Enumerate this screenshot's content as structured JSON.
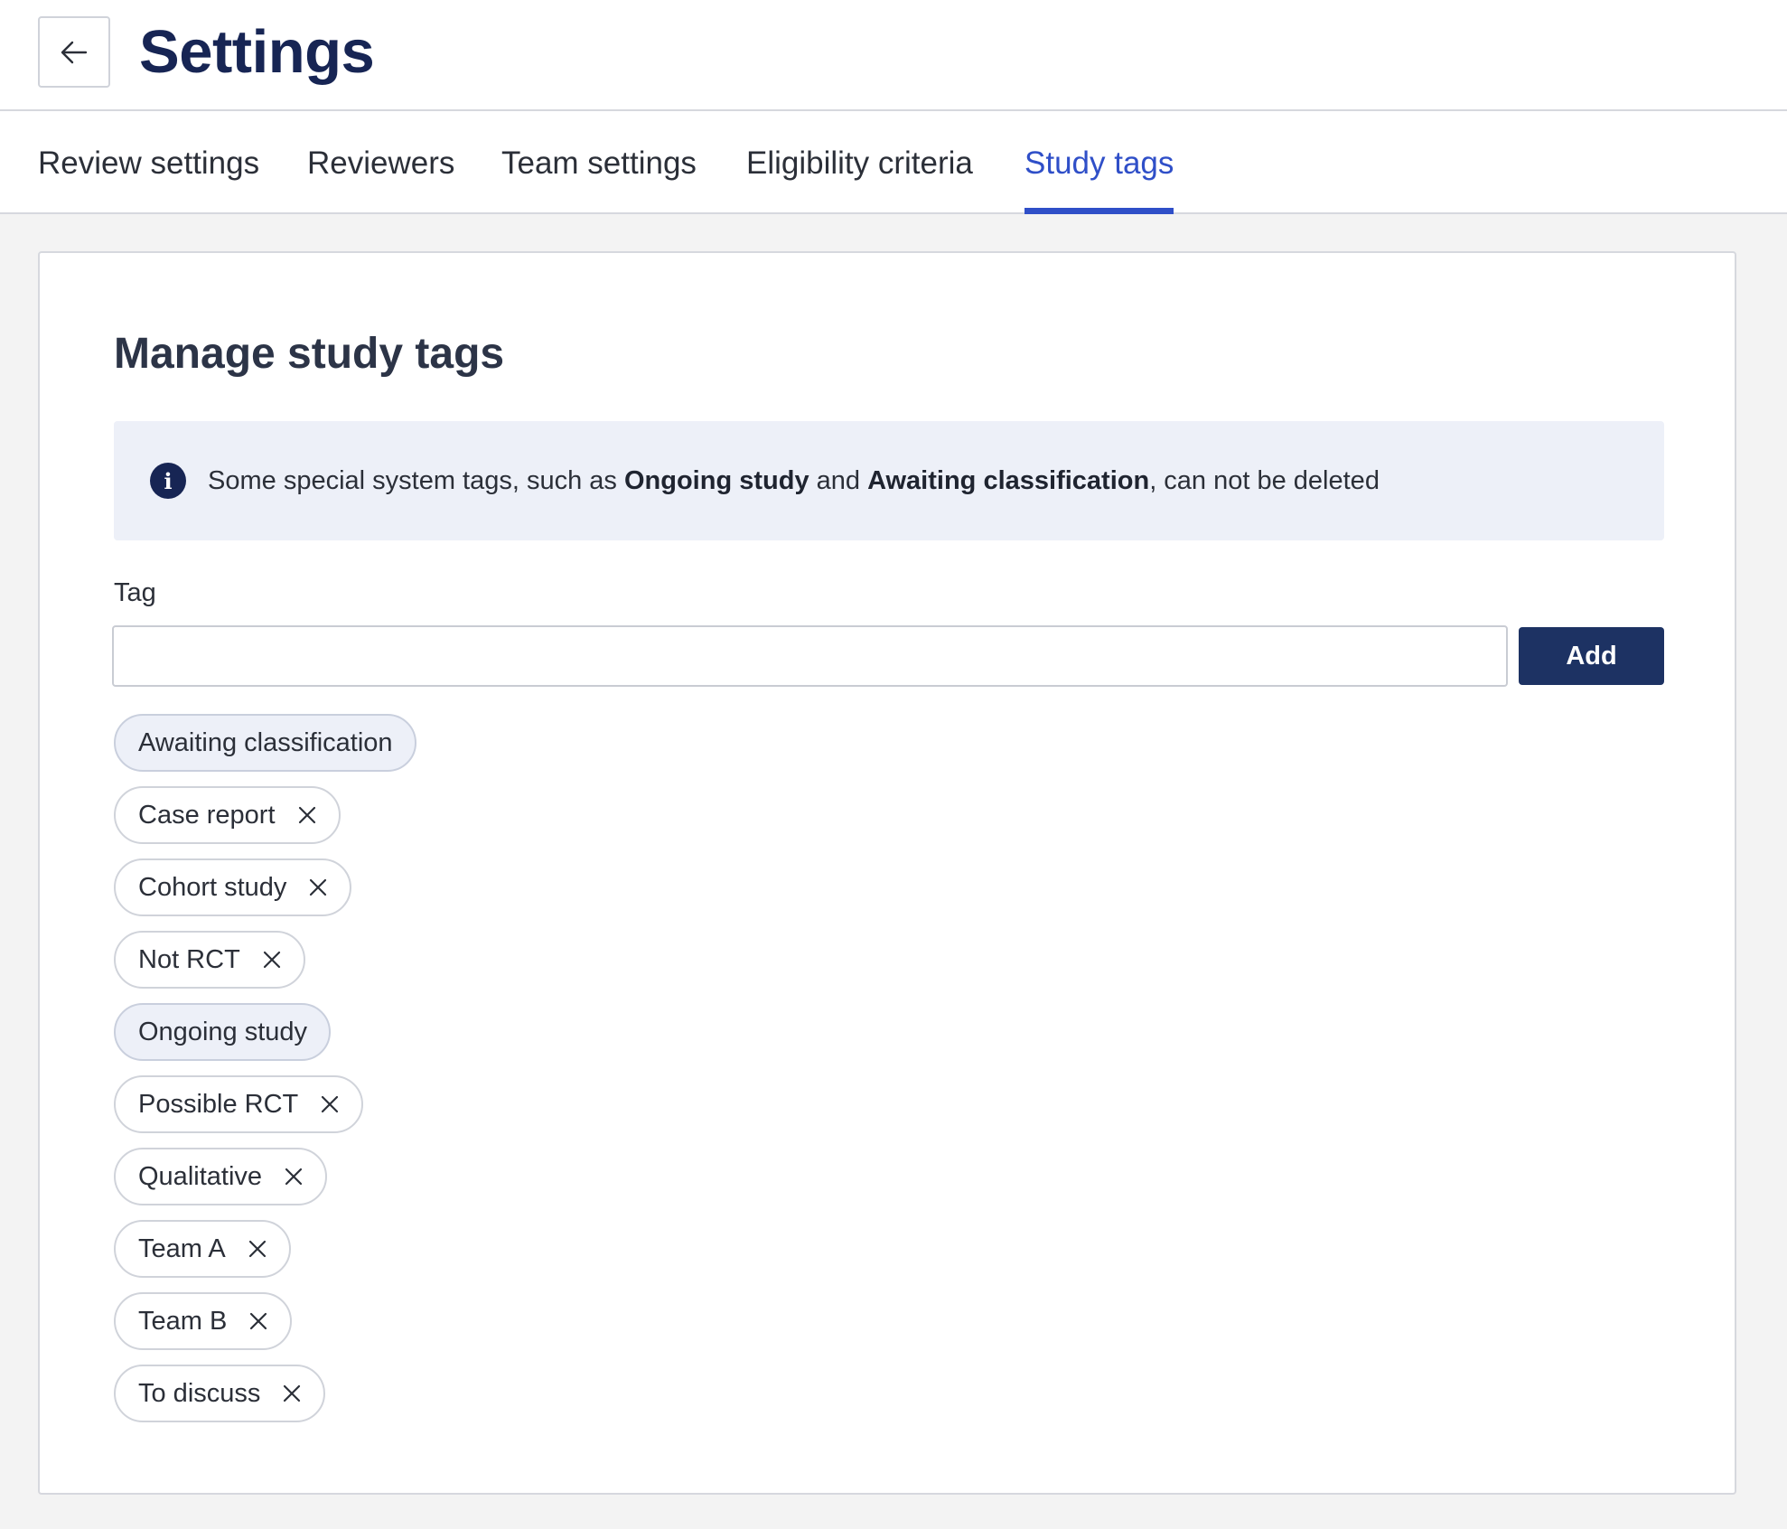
{
  "header": {
    "back_icon": "arrow-left-icon",
    "title": "Settings"
  },
  "tabs": [
    {
      "label": "Review settings",
      "active": false
    },
    {
      "label": "Reviewers",
      "active": false
    },
    {
      "label": "Team settings",
      "active": false
    },
    {
      "label": "Eligibility criteria",
      "active": false
    },
    {
      "label": "Study tags",
      "active": true
    }
  ],
  "main": {
    "title": "Manage study tags",
    "info": {
      "icon": "info-icon",
      "text_before": "Some special system tags, such as ",
      "bold_1": "Ongoing study",
      "text_middle": " and ",
      "bold_2": "Awaiting classification",
      "text_after": ", can not be deleted"
    },
    "tag_field": {
      "label": "Tag",
      "value": "",
      "placeholder": ""
    },
    "add_label": "Add",
    "tags": [
      {
        "label": "Awaiting classification",
        "system": true
      },
      {
        "label": "Case report",
        "system": false
      },
      {
        "label": "Cohort study",
        "system": false
      },
      {
        "label": "Not RCT",
        "system": false
      },
      {
        "label": "Ongoing study",
        "system": true
      },
      {
        "label": "Possible RCT",
        "system": false
      },
      {
        "label": "Qualitative",
        "system": false
      },
      {
        "label": "Team A",
        "system": false
      },
      {
        "label": "Team B",
        "system": false
      },
      {
        "label": "To discuss",
        "system": false
      }
    ]
  },
  "colors": {
    "accent": "#2f4fc8",
    "primary_dark": "#1d3263",
    "title": "#172554",
    "info_bg": "#edf0f8"
  }
}
